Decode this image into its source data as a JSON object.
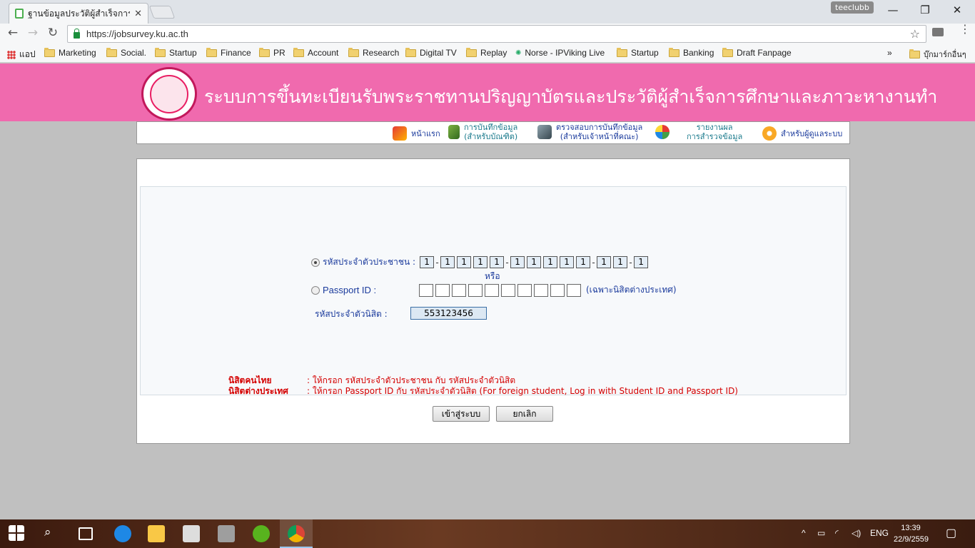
{
  "browser": {
    "tab_title": "ฐานข้อมูลประวัติผู้สำเร็จการศึ",
    "tab_close": "✕",
    "profile_name": "teeclubb",
    "url": "https://jobsurvey.ku.ac.th",
    "back_icon": "←",
    "forward_icon": "→",
    "reload_icon": "↻",
    "star_icon": "☆"
  },
  "bookmarks": {
    "apps_label": "แอป",
    "items": [
      "Marketing",
      "Social.",
      "Startup",
      "Finance",
      "PR",
      "Account",
      "Research",
      "Digital TV",
      "Replay",
      "Norse - IPViking Live",
      "Startup",
      "Banking",
      "Draft Fanpage"
    ],
    "more": "»",
    "other": "บุ๊กมาร์กอื่นๆ"
  },
  "header": {
    "title": "ระบบการขึ้นทะเบียนรับพระราชทานปริญญาบัตรและประวัติผู้สำเร็จการศึกษาและภาวะหางานทำ"
  },
  "menu": {
    "home": "หน้าแรก",
    "record_line1": "การบันทึกข้อมูล",
    "record_line2": "(สำหรับบัณฑิต)",
    "check_line1": "ตรวจสอบการบันทึกข้อมูล",
    "check_line2": "(สำหรับเจ้าหน้าที่คณะ)",
    "report_line1": "รายงานผล",
    "report_line2": "การสำรวจข้อมูล",
    "admin": "สำหรับผู้ดูแลระบบ"
  },
  "form": {
    "citizen_label": "รหัสประจำตัวประชาชน :",
    "citizen_digits": [
      "1",
      "1",
      "1",
      "1",
      "1",
      "1",
      "1",
      "1",
      "1",
      "1",
      "1",
      "1",
      "1"
    ],
    "or": "หรือ",
    "passport_label": "Passport ID :",
    "passport_note": "(เฉพาะนิสิตต่างประเทศ)",
    "student_label": "รหัสประจำตัวนิสิต :",
    "student_id": "553123456"
  },
  "notes": {
    "thai_key": "นิสิตคนไทย",
    "thai_val": ": ให้กรอก รหัสประจำตัวประชาชน กับ รหัสประจำตัวนิสิต",
    "foreign_key": "นิสิตต่างประเทศ",
    "foreign_val": ": ให้กรอก Passport ID กับ รหัสประจำตัวนิสิต (For foreign student, Log in with Student ID and Passport ID)"
  },
  "buttons": {
    "login": "เข้าสู่ระบบ",
    "cancel": "ยกเลิก"
  },
  "taskbar": {
    "lang": "ENG",
    "time": "13:39",
    "date": "22/9/2559"
  },
  "colors": {
    "banner": "#f06aae",
    "note_red": "#d40000",
    "link_blue": "#1a3a9c"
  }
}
